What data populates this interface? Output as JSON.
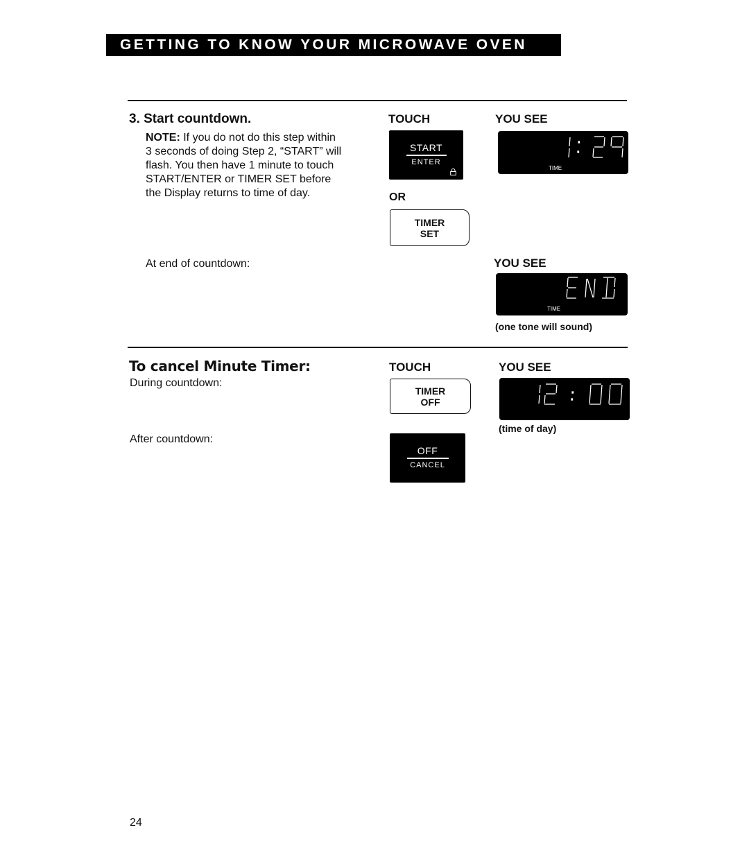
{
  "header": {
    "title": "GETTING TO KNOW YOUR MICROWAVE OVEN"
  },
  "step3": {
    "heading": "3. Start countdown.",
    "note_label": "NOTE:",
    "note_lines": [
      " If you do not do this step within",
      "3 seconds of doing Step 2, “START” will",
      "flash. You then have 1 minute to touch",
      "START/ENTER or TIMER SET before",
      "the Display returns to time of day."
    ],
    "touch_label": "TOUCH",
    "you_see_label": "YOU SEE",
    "start_button": {
      "top": "START",
      "bottom": "ENTER",
      "icon": "lock-icon"
    },
    "or_label": "OR",
    "timer_set_button": {
      "line1": "TIMER",
      "line2": "SET"
    },
    "display1": {
      "text": "1:29",
      "indicator": "TIME"
    },
    "end_label": "At end of countdown:",
    "you_see_label2": "YOU SEE",
    "display2": {
      "text": "END",
      "indicator": "TIME"
    },
    "display2_caption": "(one tone will sound)"
  },
  "cancel": {
    "heading": "To cancel Minute Timer:",
    "during_label": "During countdown:",
    "after_label": "After countdown:",
    "touch_label": "TOUCH",
    "you_see_label": "YOU SEE",
    "timer_off_button": {
      "line1": "TIMER",
      "line2": "OFF"
    },
    "off_cancel_button": {
      "top": "OFF",
      "bottom": "CANCEL"
    },
    "display3": {
      "text": "12:00"
    },
    "display3_caption": "(time of day)"
  },
  "footer": {
    "page_number": "24"
  }
}
